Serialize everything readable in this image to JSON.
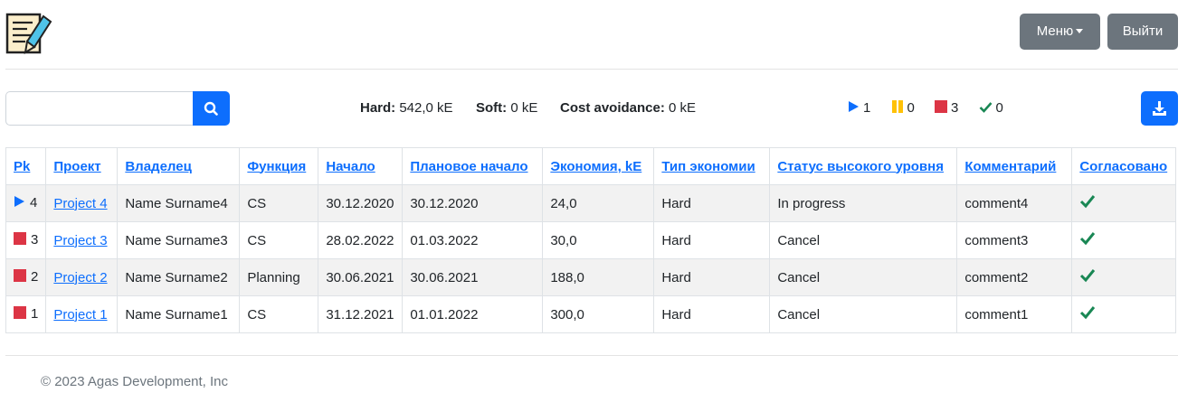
{
  "header": {
    "menu_label": "Меню",
    "exit_label": "Выйти"
  },
  "toolbar": {
    "search": {
      "value": "",
      "placeholder": ""
    },
    "hard_label": "Hard:",
    "hard_value": "542,0 kE",
    "soft_label": "Soft:",
    "soft_value": "0 kE",
    "cost_label": "Cost avoidance:",
    "cost_value": "0 kE",
    "counts": {
      "in_progress": "1",
      "paused": "0",
      "cancelled": "3",
      "done": "0"
    }
  },
  "table": {
    "headers": [
      "Pk",
      "Проект",
      "Владелец",
      "Функция",
      "Начало",
      "Плановое начало",
      "Экономия, kE",
      "Тип экономии",
      "Статус высокого уровня",
      "Комментарий",
      "Согласовано"
    ],
    "rows": [
      {
        "status_icon": "play-icon",
        "pk": "4",
        "project": "Project 4",
        "owner": "Name Surname4",
        "function": "CS",
        "start": "30.12.2020",
        "planned_start": "30.12.2020",
        "savings": "24,0",
        "type": "Hard",
        "status": "In progress",
        "comment": "comment4"
      },
      {
        "status_icon": "stop-icon",
        "pk": "3",
        "project": "Project 3",
        "owner": "Name Surname3",
        "function": "CS",
        "start": "28.02.2022",
        "planned_start": "01.03.2022",
        "savings": "30,0",
        "type": "Hard",
        "status": "Cancel",
        "comment": "comment3"
      },
      {
        "status_icon": "stop-icon",
        "pk": "2",
        "project": "Project 2",
        "owner": "Name Surname2",
        "function": "Planning",
        "start": "30.06.2021",
        "planned_start": "30.06.2021",
        "savings": "188,0",
        "type": "Hard",
        "status": "Cancel",
        "comment": "comment2"
      },
      {
        "status_icon": "stop-icon",
        "pk": "1",
        "project": "Project 1",
        "owner": "Name Surname1",
        "function": "CS",
        "start": "31.12.2021",
        "planned_start": "01.01.2022",
        "savings": "300,0",
        "type": "Hard",
        "status": "Cancel",
        "comment": "comment1"
      }
    ]
  },
  "footer": {
    "copyright": "© 2023 Agas Development, Inc"
  },
  "colors": {
    "primary": "#0d6efd",
    "secondary": "#6c757d",
    "danger": "#dc3545",
    "warning": "#ffc107",
    "success": "#198754"
  }
}
